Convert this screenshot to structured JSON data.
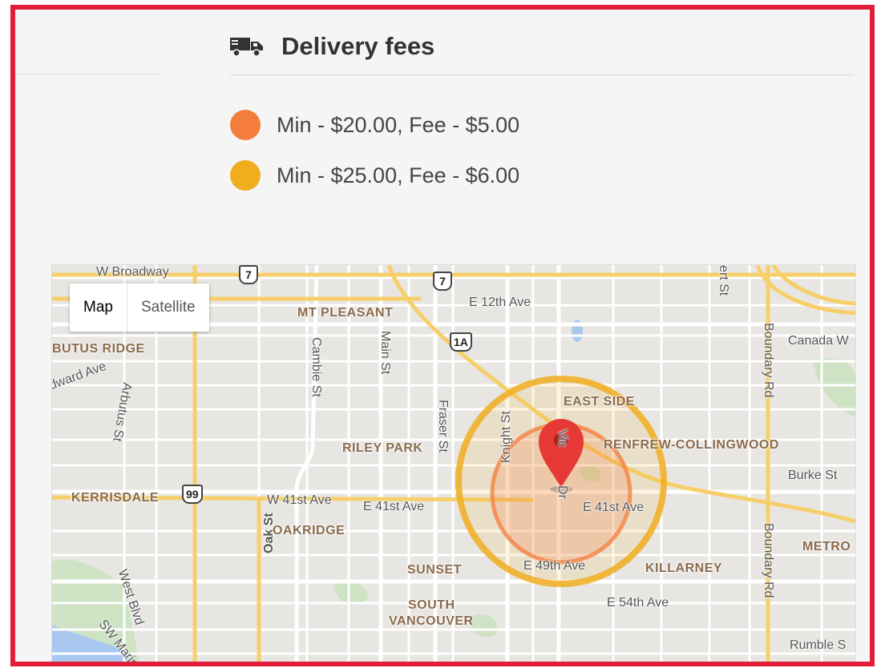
{
  "header": {
    "title": "Delivery fees",
    "icon": "truck-icon"
  },
  "legend": [
    {
      "text": "Min - $20.00, Fee - $5.00",
      "color": "#f47c3c"
    },
    {
      "text": "Min - $25.00, Fee - $6.00",
      "color": "#f0ad1e"
    }
  ],
  "map": {
    "toggle": {
      "map_label": "Map",
      "satellite_label": "Satellite"
    },
    "streets": {
      "w_broadway": "W Broadway",
      "e_12th": "E 12th Ave",
      "canada_way": "Canada W",
      "boundary_1": "Boundary Rd",
      "boundary_2": "Boundary Rd",
      "edward": "dward Ave",
      "arbutus": "Arbutus St",
      "cambie": "Cambie St",
      "main": "Main St",
      "fraser": "Fraser St",
      "knight": "Knight St",
      "victoria": "Vic",
      "dr": "Dr",
      "burke": "Burke St",
      "w_41st": "W 41st Ave",
      "e_41st_a": "E 41st Ave",
      "e_41st_b": "E 41st Ave",
      "oak": "Oak St",
      "e_49th": "E 49th Ave",
      "e_54th": "E 54th Ave",
      "west_blvd": "West Blvd",
      "sw_marine": "SW Marin",
      "rumble": "Rumble S",
      "ert": "ert St"
    },
    "neighborhoods": {
      "mt_pleasant": "MT PLEASANT",
      "arbutus_ridge": "BUTUS RIDGE",
      "east_side": "EAST SIDE",
      "riley_park": "RILEY PARK",
      "renfrew": "RENFREW-COLLINGWOOD",
      "kerrisdale": "KERRISDALE",
      "oakridge": "OAKRIDGE",
      "metro": "METRO",
      "sunset": "SUNSET",
      "killarney": "KILLARNEY",
      "south": "SOUTH",
      "vancouver": "VANCOUVER"
    },
    "shields": {
      "hwy7_a": "7",
      "hwy7_b": "7",
      "hwy1a": "1A",
      "hwy99": "99"
    },
    "zones": [
      {
        "color": "#f47c3c",
        "fee_level": 1
      },
      {
        "color": "#f0ad1e",
        "fee_level": 2
      }
    ],
    "marker_color": "#e53935"
  }
}
